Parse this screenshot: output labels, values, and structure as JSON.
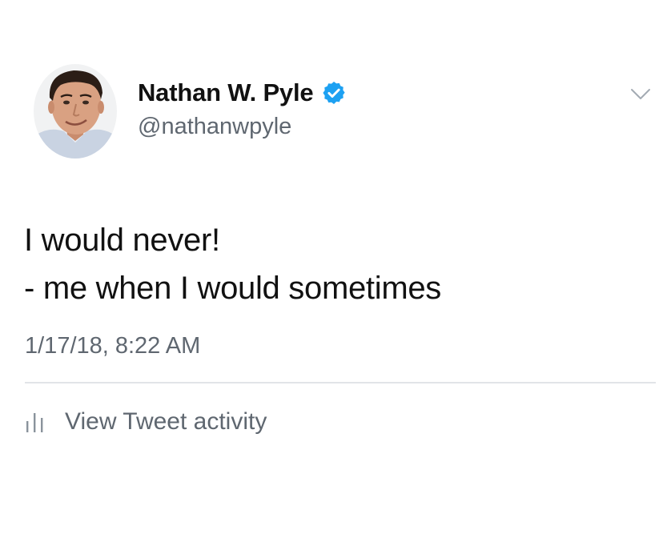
{
  "tweet": {
    "author": {
      "display_name": "Nathan W. Pyle",
      "handle": "@nathanwpyle",
      "verified": true
    },
    "text_lines": [
      "I would never!",
      "- me when I would sometimes"
    ],
    "timestamp": "1/17/18, 8:22 AM"
  },
  "actions": {
    "activity_label": "View Tweet activity"
  },
  "colors": {
    "verified_badge": "#1da1f2",
    "secondary_text": "#5f6770",
    "divider": "#e1e4e8"
  },
  "icons": {
    "menu": "chevron-down-icon",
    "activity": "bar-chart-icon",
    "verified": "verified-badge-icon"
  }
}
